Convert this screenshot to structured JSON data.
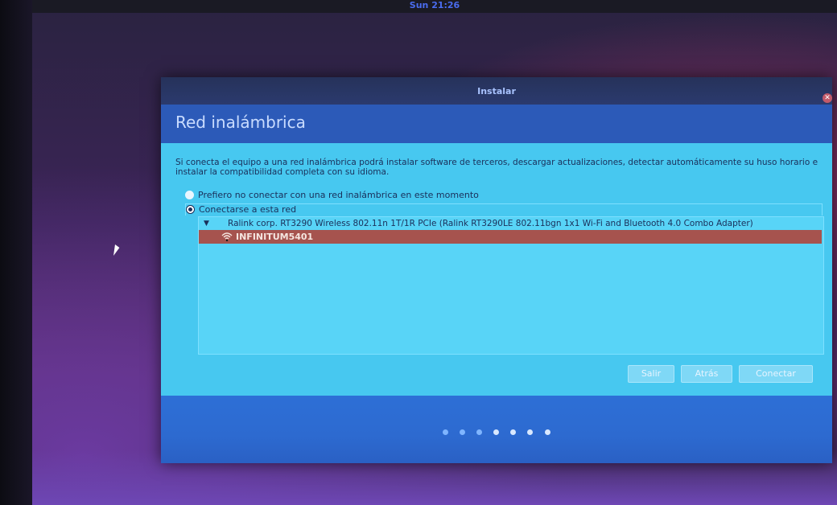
{
  "topbar": {
    "clock": "Sun 21:26"
  },
  "window": {
    "title": "Instalar",
    "heading": "Red inalámbrica",
    "intro_text": "Si conecta el equipo a una red inalámbrica podrá instalar software de terceros, descargar actualizaciones, detectar automáticamente su huso horario e instalar la compatibilidad completa con su idioma.",
    "options": [
      {
        "label": "Prefiero no conectar con una red inalámbrica en este momento",
        "selected": false
      },
      {
        "label": "Conectarse a esta red",
        "selected": true
      }
    ],
    "adapter": "Ralink corp. RT3290 Wireless 802.11n 1T/1R PCIe (Ralink RT3290LE 802.11bgn 1x1 Wi-Fi and Bluetooth 4.0 Combo Adapter)",
    "network": "INFINITUM5401",
    "buttons": {
      "quit": "Salir",
      "back": "Atrás",
      "connect": "Conectar"
    },
    "steps_total": 7,
    "steps_active": 7
  },
  "colors": {
    "selected_row": "#a6534e",
    "content_bg": "#47c8f0",
    "footer_bg": "#2d6ad0"
  }
}
